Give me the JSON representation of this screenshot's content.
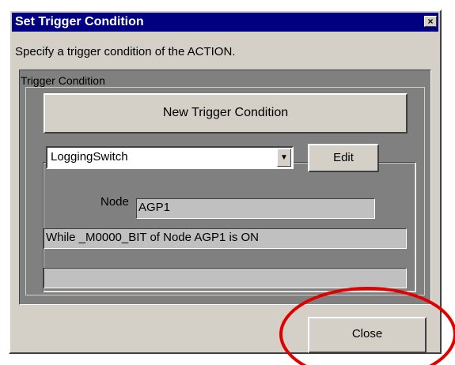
{
  "window": {
    "title": "Set Trigger Condition",
    "close_glyph": "×"
  },
  "instruction": "Specify a trigger condition of the ACTION.",
  "trigger_group": {
    "label": "Trigger Condition",
    "new_button_label": "New Trigger Condition",
    "selected_trigger": "LoggingSwitch",
    "dropdown_icon": "▼",
    "edit_button_label": "Edit",
    "node_label": "Node",
    "node_value": "AGP1",
    "description": "While _M0000_BIT of Node AGP1 is ON",
    "extra_value": ""
  },
  "footer": {
    "close_button_label": "Close"
  },
  "colors": {
    "title_bar": "#000080",
    "dialog_face": "#d4d0c8",
    "group_background": "#808080",
    "annotation_circle": "#e00000"
  }
}
